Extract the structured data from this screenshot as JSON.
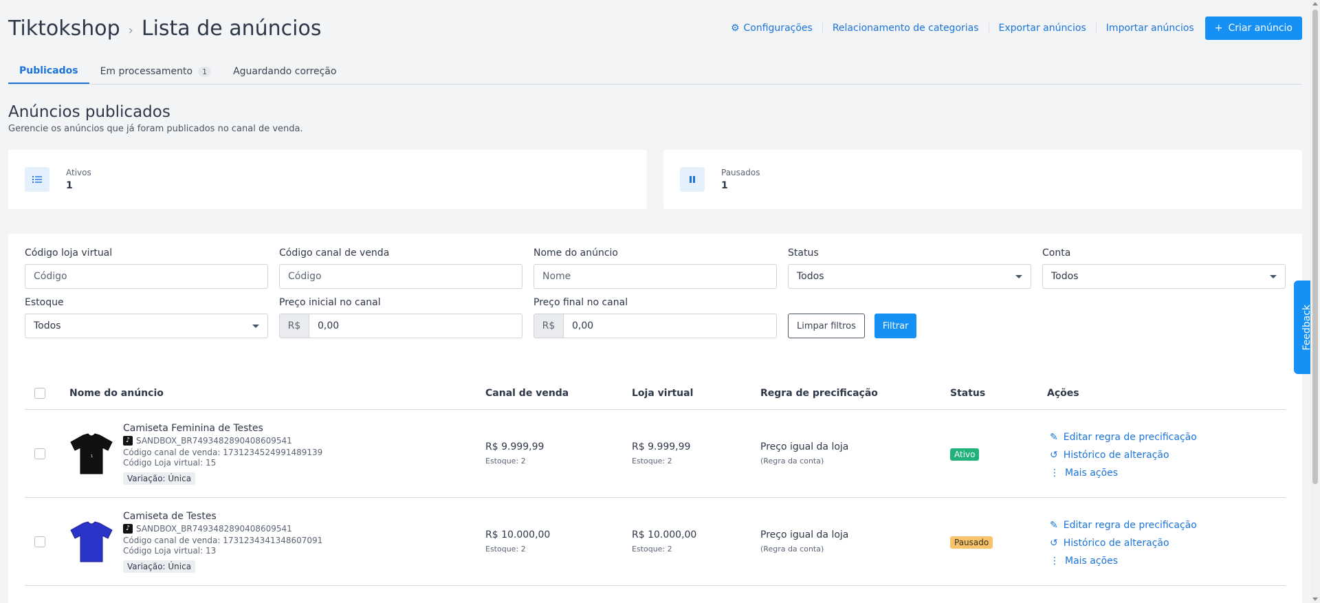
{
  "header": {
    "store": "Tiktokshop",
    "title": "Lista de anúncios",
    "links": {
      "config": "Configurações",
      "categories": "Relacionamento de categorias",
      "export": "Exportar anúncios",
      "import": "Importar anúncios"
    },
    "create_button": "Criar anúncio"
  },
  "tabs": {
    "published": "Publicados",
    "processing": "Em processamento",
    "processing_count": "1",
    "awaiting": "Aguardando correção"
  },
  "section": {
    "title": "Anúncios publicados",
    "subtitle": "Gerencie os anúncios que já foram publicados no canal de venda."
  },
  "stats": {
    "active_label": "Ativos",
    "active_value": "1",
    "paused_label": "Pausados",
    "paused_value": "1"
  },
  "filters": {
    "code_store_label": "Código loja virtual",
    "code_store_placeholder": "Código",
    "code_channel_label": "Código canal de venda",
    "code_channel_placeholder": "Código",
    "name_label": "Nome do anúncio",
    "name_placeholder": "Nome",
    "status_label": "Status",
    "status_value": "Todos",
    "account_label": "Conta",
    "account_value": "Todos",
    "stock_label": "Estoque",
    "stock_value": "Todos",
    "price_start_label": "Preço inicial no canal",
    "price_start_prefix": "R$",
    "price_start_value": "0,00",
    "price_end_label": "Preço final no canal",
    "price_end_prefix": "R$",
    "price_end_value": "0,00",
    "clear_button": "Limpar filtros",
    "filter_button": "Filtrar"
  },
  "table": {
    "headers": {
      "name": "Nome do anúncio",
      "channel": "Canal de venda",
      "store": "Loja virtual",
      "rule": "Regra de precificação",
      "status": "Status",
      "actions": "Ações"
    },
    "rows": [
      {
        "title": "Camiseta Feminina de Testes",
        "sku": "SANDBOX_BR7493482890408609541",
        "channel_code": "Código canal de venda: 1731234524991489139",
        "store_code": "Código Loja virtual: 15",
        "variation": "Variação: Única",
        "channel_price": "R$ 9.999,99",
        "channel_stock": "Estoque: 2",
        "store_price": "R$ 9.999,99",
        "store_stock": "Estoque: 2",
        "rule": "Preço igual da loja",
        "rule_note": "(Regra da conta)",
        "status": "Ativo",
        "shirt_color": "#111111",
        "action_edit": "Editar regra de precificação",
        "action_history": "Histórico de alteração",
        "action_more": "Mais ações"
      },
      {
        "title": "Camiseta de Testes",
        "sku": "SANDBOX_BR7493482890408609541",
        "channel_code": "Código canal de venda: 1731234341348607091",
        "store_code": "Código Loja virtual: 13",
        "variation": "Variação: Única",
        "channel_price": "R$ 10.000,00",
        "channel_stock": "Estoque: 2",
        "store_price": "R$ 10.000,00",
        "store_stock": "Estoque: 2",
        "rule": "Preço igual da loja",
        "rule_note": "(Regra da conta)",
        "status": "Pausado",
        "shirt_color": "#2b34c9",
        "action_edit": "Editar regra de precificação",
        "action_history": "Histórico de alteração",
        "action_more": "Mais ações"
      }
    ]
  },
  "feedback": "Feedback",
  "colors": {
    "primary": "#1590f5",
    "link": "#1a73d9",
    "active": "#20b27a",
    "paused": "#f7c46c"
  }
}
